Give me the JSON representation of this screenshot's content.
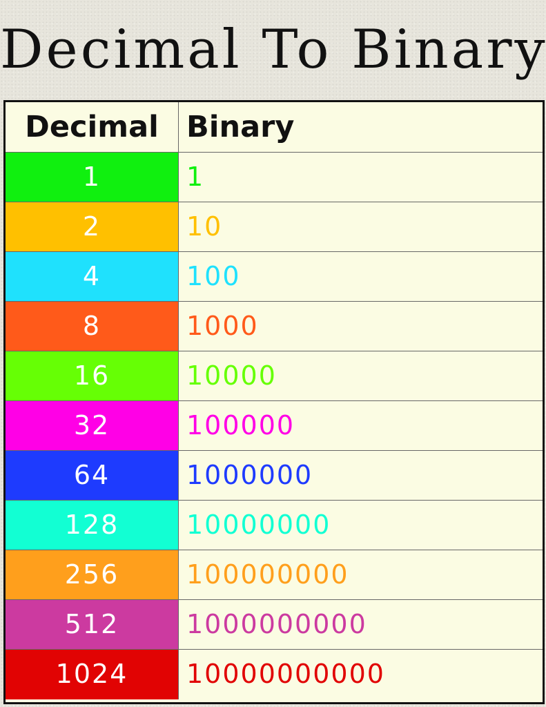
{
  "title": "Decimal To Binary",
  "table": {
    "headers": {
      "decimal": "Decimal",
      "binary": "Binary"
    },
    "rows": [
      {
        "decimal": "1",
        "binary": "1",
        "color": "#10f00f"
      },
      {
        "decimal": "2",
        "binary": "10",
        "color": "#ffc000"
      },
      {
        "decimal": "4",
        "binary": "100",
        "color": "#1fe1fd"
      },
      {
        "decimal": "8",
        "binary": "1000",
        "color": "#ff5a1a"
      },
      {
        "decimal": "16",
        "binary": "10000",
        "color": "#66ff05"
      },
      {
        "decimal": "32",
        "binary": "100000",
        "color": "#ff00e6"
      },
      {
        "decimal": "64",
        "binary": "1000000",
        "color": "#1e3bfe"
      },
      {
        "decimal": "128",
        "binary": "10000000",
        "color": "#12ffd3"
      },
      {
        "decimal": "256",
        "binary": "100000000",
        "color": "#ff9f1c"
      },
      {
        "decimal": "512",
        "binary": "1000000000",
        "color": "#cc3aa0"
      },
      {
        "decimal": "1024",
        "binary": "10000000000",
        "color": "#e10303"
      }
    ]
  }
}
